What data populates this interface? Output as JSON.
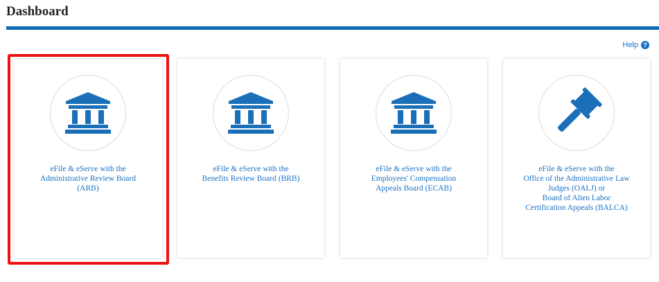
{
  "page": {
    "title": "Dashboard"
  },
  "help": {
    "label": "Help"
  },
  "colors": {
    "accent": "#0b6ab5",
    "link": "#1a72c4",
    "highlight": "#ee1111"
  },
  "cards": [
    {
      "icon": "building-icon",
      "lines": [
        "eFile & eServe with the",
        "Administrative Review Board",
        "(ARB)"
      ]
    },
    {
      "icon": "building-icon",
      "lines": [
        "eFile & eServe with the",
        "Benefits Review Board (BRB)"
      ]
    },
    {
      "icon": "building-icon",
      "lines": [
        "eFile & eServe with the",
        "Employees' Compensation",
        "Appeals Board (ECAB)"
      ]
    },
    {
      "icon": "gavel-icon",
      "lines": [
        "eFile & eServe with the",
        "Office of the Administrative Law",
        "Judges (OALJ) or",
        "Board of Alien Labor",
        "Certification Appeals (BALCA)"
      ]
    }
  ]
}
